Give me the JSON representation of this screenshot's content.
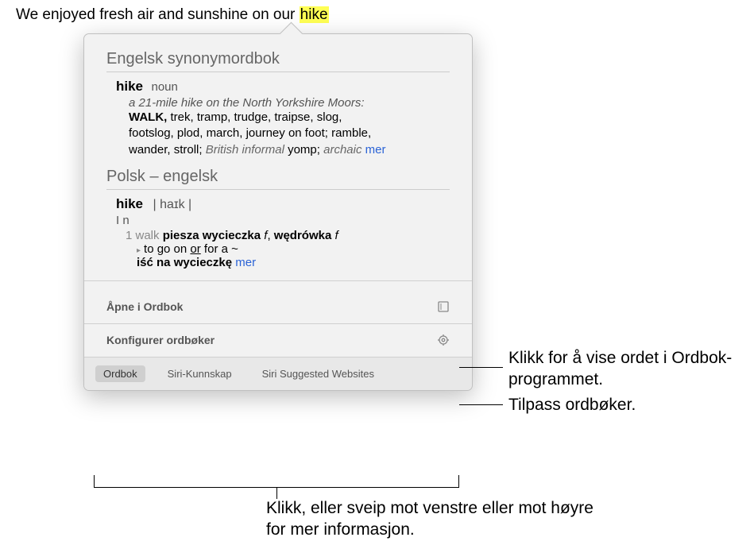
{
  "sentence_pre": "We enjoyed fresh air and sunshine on our ",
  "sentence_highlight": "hike",
  "thesaurus": {
    "title": "Engelsk synonymordbok",
    "headword": "hike",
    "pos": "noun",
    "example": "a 21-mile hike on the North Yorkshire Moors",
    "caps_first": "WALK,",
    "syns_rest1": " trek, tramp, trudge, traipse, slog,",
    "syns_line2": "footslog, plod, march, journey on foot; ramble,",
    "syns_line3a": "wander, stroll; ",
    "label_british": "British informal",
    "yomp": " yomp; ",
    "label_archaic": "archaic",
    "more": " mer"
  },
  "bilingual": {
    "title": "Polsk – engelsk",
    "headword": "hike",
    "pron": "| haɪk |",
    "roman": "I",
    "n_label": " n",
    "num": "1",
    "en_word": " walk ",
    "pl1": "piesza wycieczka",
    "f1": " f",
    "comma": ", ",
    "pl2": "wędrówka",
    "f2": " f",
    "idiom_pre": "to go on ",
    "or": "or",
    "idiom_post": " for a ~",
    "idiom_trans": "iść na wycieczkę",
    "more": " mer"
  },
  "actions": {
    "open": "Åpne i Ordbok",
    "configure": "Konfigurer ordbøker"
  },
  "tabs": {
    "dict": "Ordbok",
    "siri_knowledge": "Siri-Kunnskap",
    "siri_websites": "Siri Suggested Websites"
  },
  "callouts": {
    "open": "Klikk for å vise ordet i Ordbok-programmet.",
    "configure": "Tilpass ordbøker.",
    "tabs": "Klikk, eller sveip mot venstre eller mot høyre for mer informasjon."
  }
}
